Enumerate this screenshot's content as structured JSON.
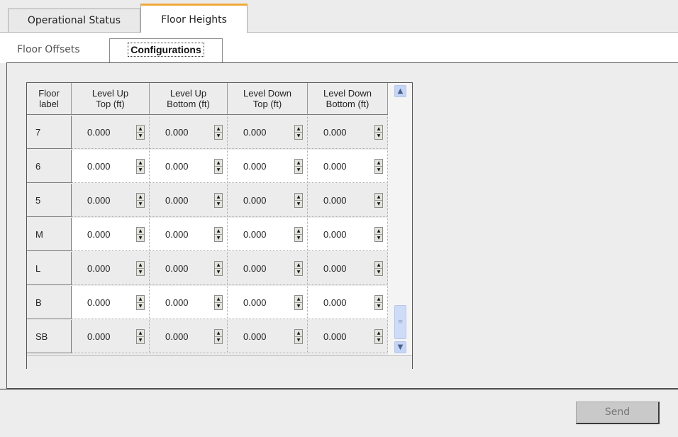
{
  "tabs": {
    "operational_status": "Operational Status",
    "floor_heights": "Floor Heights"
  },
  "subtabs": {
    "floor_offsets": "Floor Offsets",
    "configurations": "Configurations"
  },
  "table": {
    "headers": [
      "Floor\nlabel",
      "Level Up\nTop (ft)",
      "Level Up\nBottom (ft)",
      "Level Down\nTop (ft)",
      "Level Down\nBottom (ft)"
    ],
    "rows": [
      {
        "label": "7",
        "values": [
          "0.000",
          "0.000",
          "0.000",
          "0.000"
        ]
      },
      {
        "label": "6",
        "values": [
          "0.000",
          "0.000",
          "0.000",
          "0.000"
        ]
      },
      {
        "label": "5",
        "values": [
          "0.000",
          "0.000",
          "0.000",
          "0.000"
        ]
      },
      {
        "label": "M",
        "values": [
          "0.000",
          "0.000",
          "0.000",
          "0.000"
        ]
      },
      {
        "label": "L",
        "values": [
          "0.000",
          "0.000",
          "0.000",
          "0.000"
        ]
      },
      {
        "label": "B",
        "values": [
          "0.000",
          "0.000",
          "0.000",
          "0.000"
        ]
      },
      {
        "label": "SB",
        "values": [
          "0.000",
          "0.000",
          "0.000",
          "0.000"
        ]
      }
    ]
  },
  "buttons": {
    "send": "Send"
  },
  "icons": {
    "spin_up": "spin-up-icon",
    "spin_down": "spin-down-icon",
    "scroll_up": "scroll-up-icon",
    "scroll_down": "scroll-down-icon"
  },
  "colors": {
    "active_tab_accent": "#f0a93a",
    "scrollbar": "#c5d5f7"
  }
}
